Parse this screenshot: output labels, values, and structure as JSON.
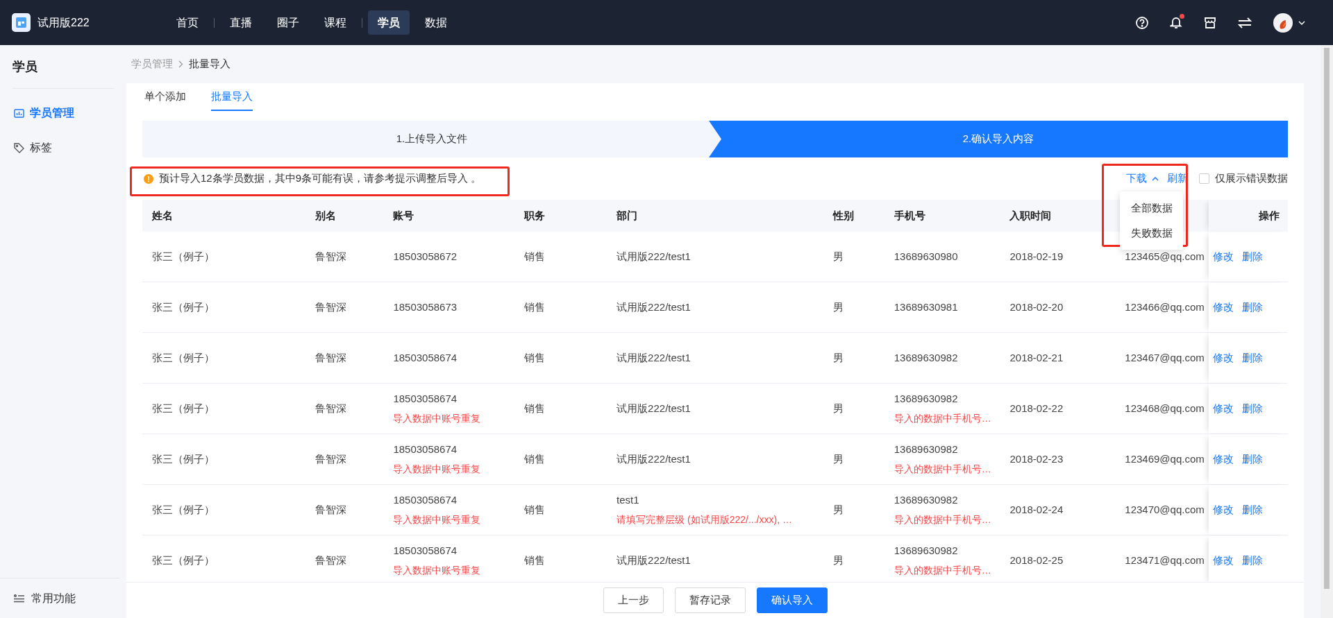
{
  "app": {
    "name": "试用版222"
  },
  "nav": [
    {
      "label": "首页",
      "selected": false,
      "separated": false
    },
    {
      "label": "直播",
      "selected": false,
      "separated": true
    },
    {
      "label": "圈子",
      "selected": false,
      "separated": false
    },
    {
      "label": "课程",
      "selected": false,
      "separated": false
    },
    {
      "label": "学员",
      "selected": true,
      "separated": true
    },
    {
      "label": "数据",
      "selected": false,
      "separated": false
    }
  ],
  "notifications": {
    "unread": true
  },
  "sidebar": {
    "title": "学员",
    "items": [
      {
        "label": "学员管理",
        "selected": true,
        "kind": "chart"
      },
      {
        "label": "标签",
        "selected": false,
        "kind": "tag"
      }
    ],
    "footer": "常用功能"
  },
  "breadcrumb": [
    "学员管理",
    "批量导入"
  ],
  "tabs": [
    {
      "label": "单个添加",
      "selected": false
    },
    {
      "label": "批量导入",
      "selected": true
    }
  ],
  "steps": [
    {
      "label": "1.上传导入文件",
      "selected": false
    },
    {
      "label": "2.确认导入内容",
      "selected": true
    }
  ],
  "alert": "预计导入12条学员数据，其中9条可能有误，请参考提示调整后导入 。",
  "toolbar": {
    "download": "下载",
    "refresh": "刷新",
    "error_only": {
      "label": "仅展示错误数据",
      "checked": false
    }
  },
  "download_menu": [
    "全部数据",
    "失败数据"
  ],
  "table": {
    "columns": [
      "姓名",
      "别名",
      "账号",
      "职务",
      "部门",
      "性别",
      "手机号",
      "入职时间",
      "操作"
    ],
    "rows": [
      {
        "name": "张三（例子）",
        "alias": "鲁智深",
        "account": "18503058672",
        "job": "销售",
        "dept": "试用版222/test1",
        "sex": "男",
        "phone": "13689630980",
        "date": "2018-02-19",
        "email": "123465@qq.com",
        "edit": "修改",
        "delete": "删除"
      },
      {
        "name": "张三（例子）",
        "alias": "鲁智深",
        "account": "18503058673",
        "job": "销售",
        "dept": "试用版222/test1",
        "sex": "男",
        "phone": "13689630981",
        "date": "2018-02-20",
        "email": "123466@qq.com",
        "edit": "修改",
        "delete": "删除"
      },
      {
        "name": "张三（例子）",
        "alias": "鲁智深",
        "account": "18503058674",
        "job": "销售",
        "dept": "试用版222/test1",
        "sex": "男",
        "phone": "13689630982",
        "date": "2018-02-21",
        "email": "123467@qq.com",
        "edit": "修改",
        "delete": "删除"
      },
      {
        "name": "张三（例子）",
        "alias": "鲁智深",
        "account": "18503058674",
        "account_error": "导入数据中账号重复",
        "job": "销售",
        "dept": "试用版222/test1",
        "sex": "男",
        "phone": "13689630982",
        "phone_error": "导入的数据中手机号…",
        "date": "2018-02-22",
        "email": "123468@qq.com",
        "edit": "修改",
        "delete": "删除"
      },
      {
        "name": "张三（例子）",
        "alias": "鲁智深",
        "account": "18503058674",
        "account_error": "导入数据中账号重复",
        "job": "销售",
        "dept": "试用版222/test1",
        "sex": "男",
        "phone": "13689630982",
        "phone_error": "导入的数据中手机号…",
        "date": "2018-02-23",
        "email": "123469@qq.com",
        "edit": "修改",
        "delete": "删除"
      },
      {
        "name": "张三（例子）",
        "alias": "鲁智深",
        "account": "18503058674",
        "account_error": "导入数据中账号重复",
        "job": "销售",
        "dept": "test1",
        "dept_error": "请填写完整层级 (如试用版222/.../xxx), …",
        "sex": "男",
        "phone": "13689630982",
        "phone_error": "导入的数据中手机号…",
        "date": "2018-02-24",
        "email": "123470@qq.com",
        "edit": "修改",
        "delete": "删除"
      },
      {
        "name": "张三（例子）",
        "alias": "鲁智深",
        "account": "18503058674",
        "account_error": "导入数据中账号重复",
        "job": "销售",
        "dept": "试用版222/test1",
        "sex": "男",
        "phone": "13689630982",
        "phone_error": "导入的数据中手机号…",
        "date": "2018-02-25",
        "email": "123471@qq.com",
        "edit": "修改",
        "delete": "删除"
      }
    ]
  },
  "footer_buttons": [
    {
      "label": "上一步",
      "kind": "default"
    },
    {
      "label": "暂存记录",
      "kind": "default"
    },
    {
      "label": "确认导入",
      "kind": "primary"
    }
  ]
}
